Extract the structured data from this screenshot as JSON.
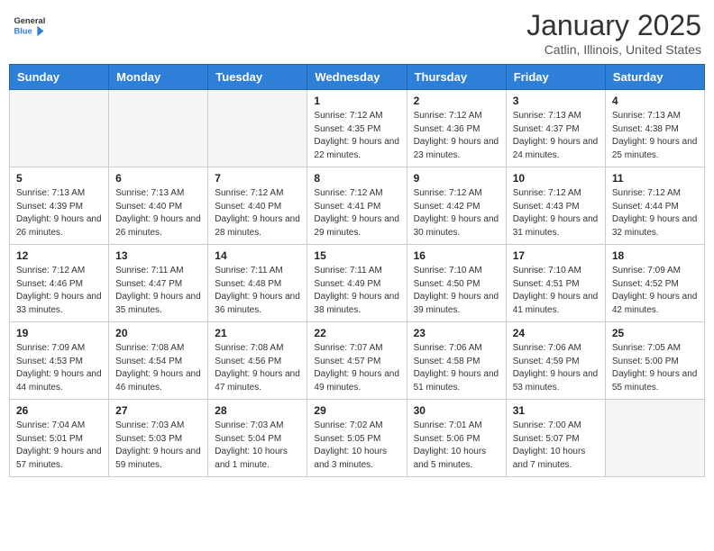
{
  "header": {
    "logo_line1": "General",
    "logo_line2": "Blue",
    "month": "January 2025",
    "location": "Catlin, Illinois, United States"
  },
  "weekdays": [
    "Sunday",
    "Monday",
    "Tuesday",
    "Wednesday",
    "Thursday",
    "Friday",
    "Saturday"
  ],
  "weeks": [
    [
      {
        "day": "",
        "info": ""
      },
      {
        "day": "",
        "info": ""
      },
      {
        "day": "",
        "info": ""
      },
      {
        "day": "1",
        "info": "Sunrise: 7:12 AM\nSunset: 4:35 PM\nDaylight: 9 hours and 22 minutes."
      },
      {
        "day": "2",
        "info": "Sunrise: 7:12 AM\nSunset: 4:36 PM\nDaylight: 9 hours and 23 minutes."
      },
      {
        "day": "3",
        "info": "Sunrise: 7:13 AM\nSunset: 4:37 PM\nDaylight: 9 hours and 24 minutes."
      },
      {
        "day": "4",
        "info": "Sunrise: 7:13 AM\nSunset: 4:38 PM\nDaylight: 9 hours and 25 minutes."
      }
    ],
    [
      {
        "day": "5",
        "info": "Sunrise: 7:13 AM\nSunset: 4:39 PM\nDaylight: 9 hours and 26 minutes."
      },
      {
        "day": "6",
        "info": "Sunrise: 7:13 AM\nSunset: 4:40 PM\nDaylight: 9 hours and 26 minutes."
      },
      {
        "day": "7",
        "info": "Sunrise: 7:12 AM\nSunset: 4:40 PM\nDaylight: 9 hours and 28 minutes."
      },
      {
        "day": "8",
        "info": "Sunrise: 7:12 AM\nSunset: 4:41 PM\nDaylight: 9 hours and 29 minutes."
      },
      {
        "day": "9",
        "info": "Sunrise: 7:12 AM\nSunset: 4:42 PM\nDaylight: 9 hours and 30 minutes."
      },
      {
        "day": "10",
        "info": "Sunrise: 7:12 AM\nSunset: 4:43 PM\nDaylight: 9 hours and 31 minutes."
      },
      {
        "day": "11",
        "info": "Sunrise: 7:12 AM\nSunset: 4:44 PM\nDaylight: 9 hours and 32 minutes."
      }
    ],
    [
      {
        "day": "12",
        "info": "Sunrise: 7:12 AM\nSunset: 4:46 PM\nDaylight: 9 hours and 33 minutes."
      },
      {
        "day": "13",
        "info": "Sunrise: 7:11 AM\nSunset: 4:47 PM\nDaylight: 9 hours and 35 minutes."
      },
      {
        "day": "14",
        "info": "Sunrise: 7:11 AM\nSunset: 4:48 PM\nDaylight: 9 hours and 36 minutes."
      },
      {
        "day": "15",
        "info": "Sunrise: 7:11 AM\nSunset: 4:49 PM\nDaylight: 9 hours and 38 minutes."
      },
      {
        "day": "16",
        "info": "Sunrise: 7:10 AM\nSunset: 4:50 PM\nDaylight: 9 hours and 39 minutes."
      },
      {
        "day": "17",
        "info": "Sunrise: 7:10 AM\nSunset: 4:51 PM\nDaylight: 9 hours and 41 minutes."
      },
      {
        "day": "18",
        "info": "Sunrise: 7:09 AM\nSunset: 4:52 PM\nDaylight: 9 hours and 42 minutes."
      }
    ],
    [
      {
        "day": "19",
        "info": "Sunrise: 7:09 AM\nSunset: 4:53 PM\nDaylight: 9 hours and 44 minutes."
      },
      {
        "day": "20",
        "info": "Sunrise: 7:08 AM\nSunset: 4:54 PM\nDaylight: 9 hours and 46 minutes."
      },
      {
        "day": "21",
        "info": "Sunrise: 7:08 AM\nSunset: 4:56 PM\nDaylight: 9 hours and 47 minutes."
      },
      {
        "day": "22",
        "info": "Sunrise: 7:07 AM\nSunset: 4:57 PM\nDaylight: 9 hours and 49 minutes."
      },
      {
        "day": "23",
        "info": "Sunrise: 7:06 AM\nSunset: 4:58 PM\nDaylight: 9 hours and 51 minutes."
      },
      {
        "day": "24",
        "info": "Sunrise: 7:06 AM\nSunset: 4:59 PM\nDaylight: 9 hours and 53 minutes."
      },
      {
        "day": "25",
        "info": "Sunrise: 7:05 AM\nSunset: 5:00 PM\nDaylight: 9 hours and 55 minutes."
      }
    ],
    [
      {
        "day": "26",
        "info": "Sunrise: 7:04 AM\nSunset: 5:01 PM\nDaylight: 9 hours and 57 minutes."
      },
      {
        "day": "27",
        "info": "Sunrise: 7:03 AM\nSunset: 5:03 PM\nDaylight: 9 hours and 59 minutes."
      },
      {
        "day": "28",
        "info": "Sunrise: 7:03 AM\nSunset: 5:04 PM\nDaylight: 10 hours and 1 minute."
      },
      {
        "day": "29",
        "info": "Sunrise: 7:02 AM\nSunset: 5:05 PM\nDaylight: 10 hours and 3 minutes."
      },
      {
        "day": "30",
        "info": "Sunrise: 7:01 AM\nSunset: 5:06 PM\nDaylight: 10 hours and 5 minutes."
      },
      {
        "day": "31",
        "info": "Sunrise: 7:00 AM\nSunset: 5:07 PM\nDaylight: 10 hours and 7 minutes."
      },
      {
        "day": "",
        "info": ""
      }
    ]
  ]
}
